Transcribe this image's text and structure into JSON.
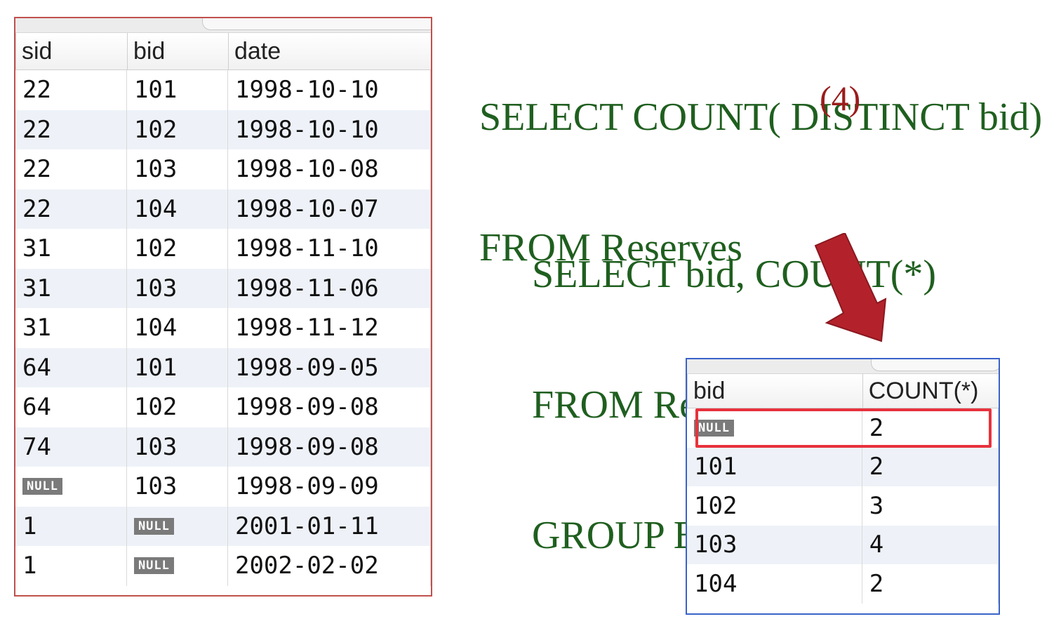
{
  "colors": {
    "left_border": "#c0504d",
    "right_border": "#3a63c9",
    "sql_text": "#1f5f1f",
    "result_text": "#9b1c1c",
    "arrow": "#b3222b",
    "highlight": "#e8323c"
  },
  "reserves_table": {
    "columns": [
      "sid",
      "bid",
      "date"
    ],
    "rows": [
      {
        "sid": "22",
        "bid": "101",
        "date": "1998-10-10"
      },
      {
        "sid": "22",
        "bid": "102",
        "date": "1998-10-10"
      },
      {
        "sid": "22",
        "bid": "103",
        "date": "1998-10-08"
      },
      {
        "sid": "22",
        "bid": "104",
        "date": "1998-10-07"
      },
      {
        "sid": "31",
        "bid": "102",
        "date": "1998-11-10"
      },
      {
        "sid": "31",
        "bid": "103",
        "date": "1998-11-06"
      },
      {
        "sid": "31",
        "bid": "104",
        "date": "1998-11-12"
      },
      {
        "sid": "64",
        "bid": "101",
        "date": "1998-09-05"
      },
      {
        "sid": "64",
        "bid": "102",
        "date": "1998-09-08"
      },
      {
        "sid": "74",
        "bid": "103",
        "date": "1998-09-08"
      },
      {
        "sid": "NULL",
        "bid": "103",
        "date": "1998-09-09"
      },
      {
        "sid": "1",
        "bid": "NULL",
        "date": "2001-01-11"
      },
      {
        "sid": "1",
        "bid": "NULL",
        "date": "2002-02-02"
      }
    ]
  },
  "query1": {
    "line1": "SELECT COUNT( DISTINCT bid)",
    "line2": "FROM Reserves",
    "result": "(4)"
  },
  "query2": {
    "line1": "SELECT bid, COUNT(*)",
    "line2": "FROM Reserves",
    "line3": "GROUP BY bid"
  },
  "group_table": {
    "columns": [
      "bid",
      "COUNT(*)"
    ],
    "rows": [
      {
        "bid": "NULL",
        "count": "2"
      },
      {
        "bid": "101",
        "count": "2"
      },
      {
        "bid": "102",
        "count": "3"
      },
      {
        "bid": "103",
        "count": "4"
      },
      {
        "bid": "104",
        "count": "2"
      }
    ]
  },
  "null_label": "NULL"
}
